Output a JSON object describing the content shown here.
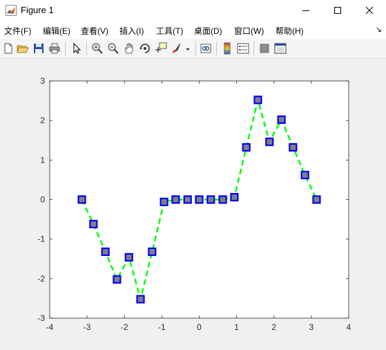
{
  "window": {
    "title": "Figure 1"
  },
  "menu": {
    "items": [
      "文件(F)",
      "编辑(E)",
      "查看(V)",
      "插入(I)",
      "工具(T)",
      "桌面(D)",
      "窗口(W)",
      "帮助(H)"
    ]
  },
  "toolbar": {
    "icons": [
      "new-figure-icon",
      "open-file-icon",
      "save-icon",
      "print-icon",
      "pointer-icon",
      "zoom-in-icon",
      "zoom-out-icon",
      "pan-icon",
      "rotate-3d-icon",
      "data-cursor-icon",
      "brush-icon",
      "link-plot-icon",
      "colorbar-icon",
      "legend-icon",
      "hide-plot-tools-icon",
      "show-plot-tools-icon"
    ]
  },
  "colors": {
    "line": "#00ff00",
    "marker_edge": "#0000ff",
    "marker_face": "#808080",
    "axes_background": "#ffffff"
  },
  "chart_data": {
    "type": "line",
    "title": "",
    "xlabel": "",
    "ylabel": "",
    "xlim": [
      -4,
      4
    ],
    "ylim": [
      -3,
      3
    ],
    "xticks": [
      -4,
      -3,
      -2,
      -1,
      0,
      1,
      2,
      3,
      4
    ],
    "yticks": [
      -3,
      -2,
      -1,
      0,
      1,
      2,
      3
    ],
    "grid": false,
    "line_style": "dashed",
    "marker": "square",
    "series": [
      {
        "x": [
          -3.14,
          -2.83,
          -2.51,
          -2.2,
          -1.88,
          -1.57,
          -1.26,
          -0.94,
          -0.63,
          -0.31,
          0,
          0.31,
          0.63,
          0.94,
          1.26,
          1.57,
          1.88,
          2.2,
          2.51,
          2.83,
          3.14
        ],
        "y": [
          0,
          -0.62,
          -1.32,
          -2.02,
          -1.46,
          -2.52,
          -1.32,
          -0.06,
          0,
          0,
          0,
          0,
          0,
          0.06,
          1.32,
          2.52,
          1.46,
          2.02,
          1.32,
          0.62,
          0
        ]
      }
    ]
  }
}
